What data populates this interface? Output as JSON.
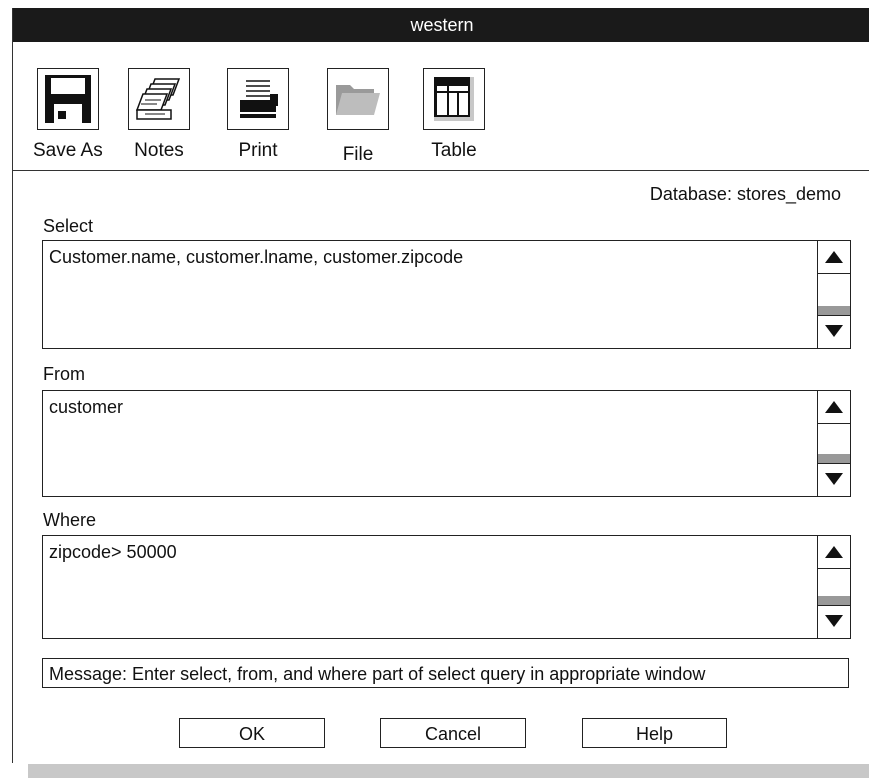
{
  "window": {
    "title": "western"
  },
  "toolbar": {
    "items": [
      {
        "label": "Save As",
        "icon": "floppy-disk-icon"
      },
      {
        "label": "Notes",
        "icon": "notes-stack-icon"
      },
      {
        "label": "Print",
        "icon": "printer-icon"
      },
      {
        "label": "File",
        "icon": "folder-icon"
      },
      {
        "label": "Table",
        "icon": "table-icon"
      }
    ]
  },
  "database": {
    "text": "Database: stores_demo"
  },
  "select": {
    "label": "Select",
    "value": "Customer.name, customer.lname, customer.zipcode"
  },
  "from": {
    "label": "From",
    "value": "customer"
  },
  "where": {
    "label": "Where",
    "value": "zipcode> 50000"
  },
  "message": {
    "text": "Message: Enter select, from, and where part of select query in appropriate window"
  },
  "buttons": {
    "ok": "OK",
    "cancel": "Cancel",
    "help": "Help"
  },
  "colors": {
    "titlebar": "#1a1a1a",
    "thumb": "#999999",
    "shadow": "#c8c8c8"
  }
}
